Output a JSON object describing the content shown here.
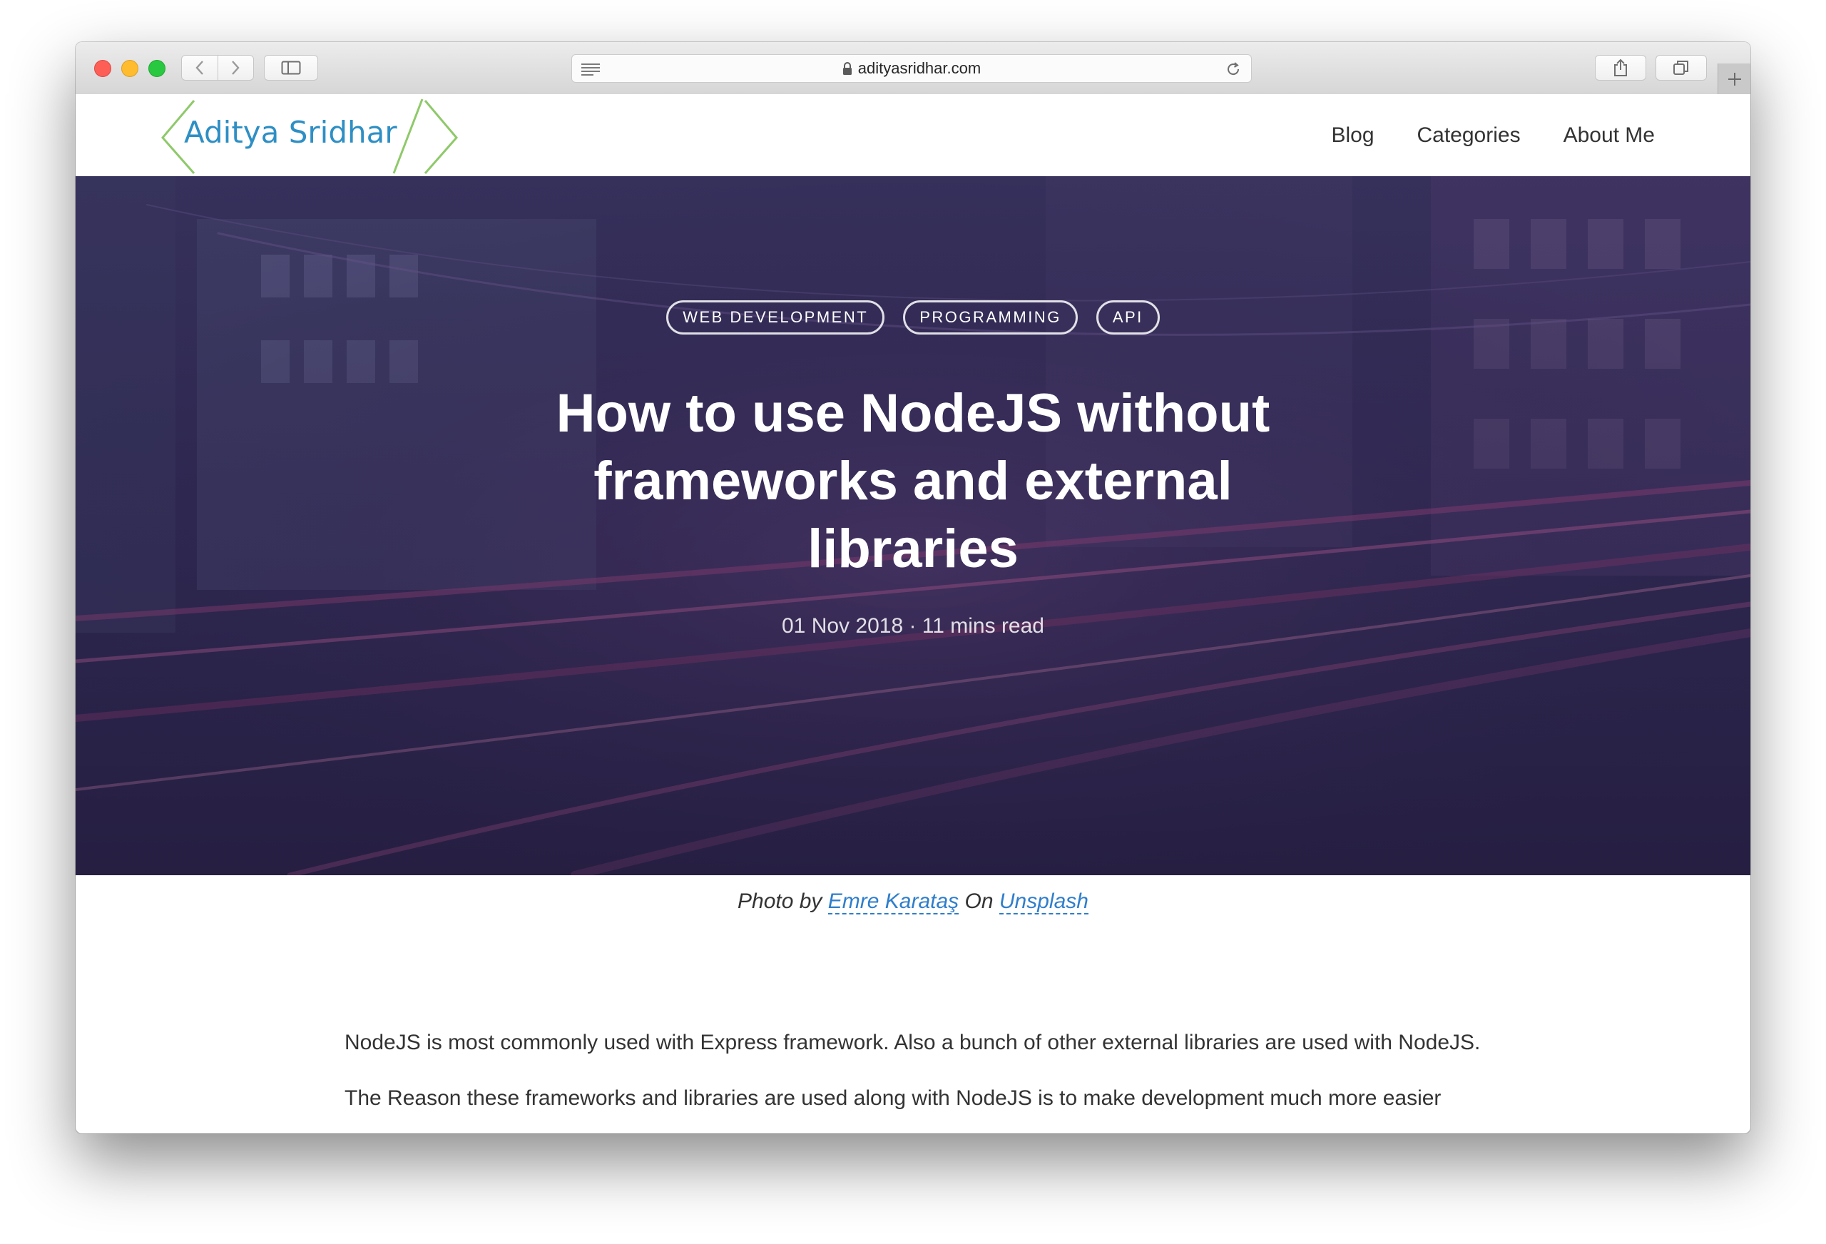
{
  "browser": {
    "url": "adityasridhar.com",
    "icons": [
      "back-icon",
      "forward-icon",
      "sidebar-icon",
      "reader-icon",
      "lock-icon",
      "reload-icon",
      "share-icon",
      "tabs-icon",
      "plus-icon"
    ]
  },
  "site": {
    "logo_text": "Aditya Sridhar",
    "nav": [
      "Blog",
      "Categories",
      "About Me"
    ]
  },
  "hero": {
    "tags": [
      "WEB DEVELOPMENT",
      "PROGRAMMING",
      "API"
    ],
    "title_lines": [
      "How to use NodeJS without",
      "frameworks and external",
      "libraries"
    ],
    "meta": "01 Nov 2018 · 11 mins read"
  },
  "caption": {
    "prefix": "Photo by ",
    "author": "Emre Karataş",
    "middle": " On ",
    "source": "Unsplash"
  },
  "content": {
    "paragraphs": [
      "NodeJS is most commonly used with Express framework. Also a bunch of other external libraries are used with NodeJS.",
      "The Reason these frameworks and libraries are used along with NodeJS is to make development much more easier"
    ]
  },
  "colors": {
    "accent_link": "#2f7ecb",
    "logo_blue": "#2e8fc4",
    "logo_green": "#8fc96a",
    "hero_overlay": "#3a2e56"
  }
}
